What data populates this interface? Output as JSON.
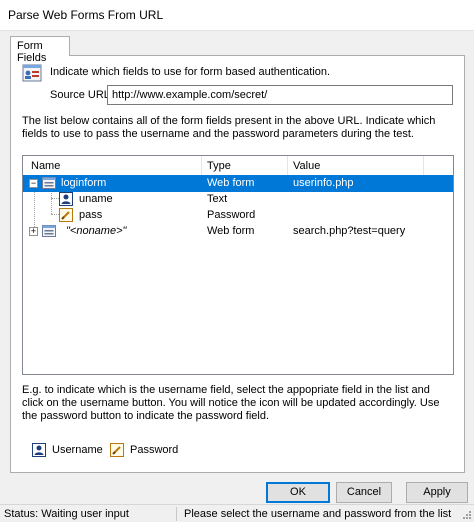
{
  "window": {
    "title": "Parse Web Forms From URL"
  },
  "tabs": [
    {
      "label": "Form Fields"
    }
  ],
  "header": {
    "text": "Indicate which fields to use for form based authentication.",
    "icon": "form-icon"
  },
  "source": {
    "label": "Source URL:",
    "value": "http://www.example.com/secret/"
  },
  "description": "The list below contains all of the form fields present in the above URL. Indicate which fields to use to pass the username and the password parameters during the test.",
  "list": {
    "columns": [
      "Name",
      "Type",
      "Value"
    ],
    "rows": [
      {
        "name": "loginform",
        "type": "Web form",
        "value": "userinfo.php",
        "expander": "−",
        "icon": "form-icon"
      },
      {
        "name": "uname",
        "type": "Text",
        "value": "",
        "icon": "username-icon"
      },
      {
        "name": "pass",
        "type": "Password",
        "value": "",
        "icon": "password-icon"
      },
      {
        "name": "\"<noname>\"",
        "type": "Web form",
        "value": "search.php?test=query",
        "expander": "+",
        "icon": "form-icon"
      }
    ]
  },
  "help": "E.g. to indicate which is the username field, select the appopriate field in the list and click on the username button. You will notice the icon will be updated accordingly. Use the password button to indicate the password field.",
  "role_buttons": {
    "username": "Username",
    "password": "Password"
  },
  "buttons": {
    "ok": "OK",
    "cancel": "Cancel",
    "apply": "Apply"
  },
  "status": {
    "left": "Status: Waiting user input",
    "right": "Please select the username and password from the list"
  },
  "colors": {
    "selection": "#0078d7",
    "dialog_bg": "#f0f0f0",
    "default_button_border": "#0078d7"
  }
}
